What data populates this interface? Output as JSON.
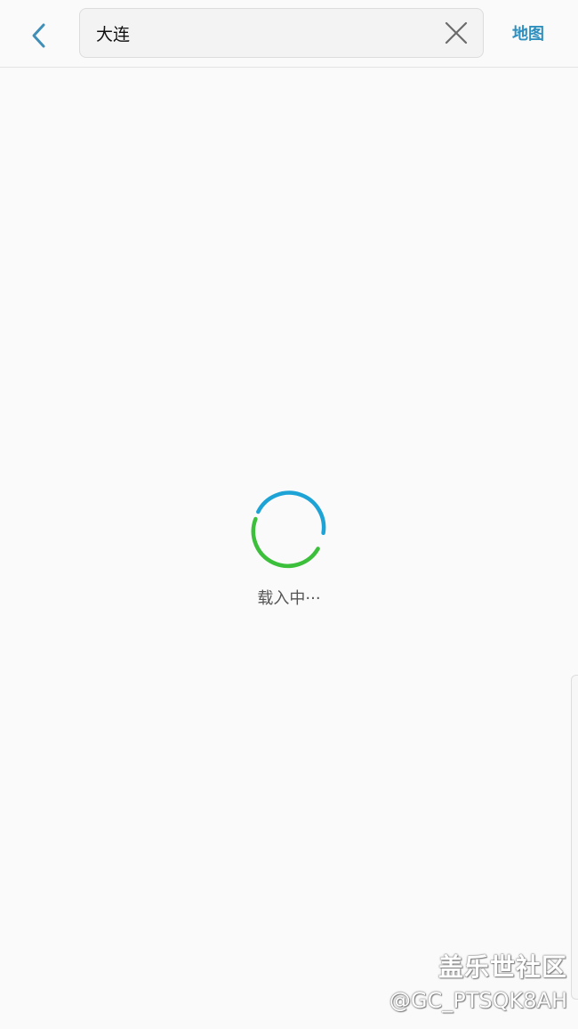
{
  "header": {
    "search": {
      "value": "大连",
      "placeholder": ""
    },
    "map_label": "地图",
    "icons": {
      "back": "chevron-left-icon",
      "clear": "close-icon"
    }
  },
  "main": {
    "loading_text": "载入中···"
  },
  "watermark": {
    "title": "盖乐世社区",
    "handle": "@GC_PTSQK8AH"
  },
  "colors": {
    "accent": "#2f8fbf",
    "spinner_blue": "#1ea3d6",
    "spinner_green": "#3cbf3a",
    "background": "#fafafa"
  }
}
